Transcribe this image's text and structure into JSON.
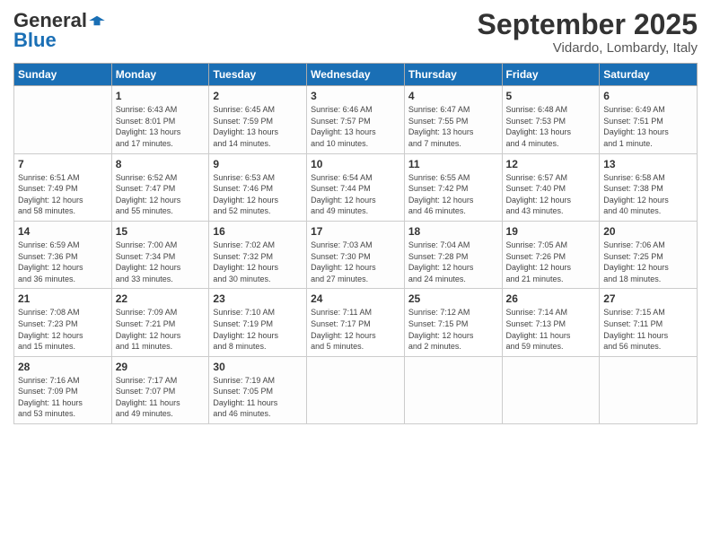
{
  "header": {
    "logo_general": "General",
    "logo_blue": "Blue",
    "month": "September 2025",
    "location": "Vidardo, Lombardy, Italy"
  },
  "days_of_week": [
    "Sunday",
    "Monday",
    "Tuesday",
    "Wednesday",
    "Thursday",
    "Friday",
    "Saturday"
  ],
  "weeks": [
    [
      {
        "day": "",
        "info": ""
      },
      {
        "day": "1",
        "info": "Sunrise: 6:43 AM\nSunset: 8:01 PM\nDaylight: 13 hours\nand 17 minutes."
      },
      {
        "day": "2",
        "info": "Sunrise: 6:45 AM\nSunset: 7:59 PM\nDaylight: 13 hours\nand 14 minutes."
      },
      {
        "day": "3",
        "info": "Sunrise: 6:46 AM\nSunset: 7:57 PM\nDaylight: 13 hours\nand 10 minutes."
      },
      {
        "day": "4",
        "info": "Sunrise: 6:47 AM\nSunset: 7:55 PM\nDaylight: 13 hours\nand 7 minutes."
      },
      {
        "day": "5",
        "info": "Sunrise: 6:48 AM\nSunset: 7:53 PM\nDaylight: 13 hours\nand 4 minutes."
      },
      {
        "day": "6",
        "info": "Sunrise: 6:49 AM\nSunset: 7:51 PM\nDaylight: 13 hours\nand 1 minute."
      }
    ],
    [
      {
        "day": "7",
        "info": "Sunrise: 6:51 AM\nSunset: 7:49 PM\nDaylight: 12 hours\nand 58 minutes."
      },
      {
        "day": "8",
        "info": "Sunrise: 6:52 AM\nSunset: 7:47 PM\nDaylight: 12 hours\nand 55 minutes."
      },
      {
        "day": "9",
        "info": "Sunrise: 6:53 AM\nSunset: 7:46 PM\nDaylight: 12 hours\nand 52 minutes."
      },
      {
        "day": "10",
        "info": "Sunrise: 6:54 AM\nSunset: 7:44 PM\nDaylight: 12 hours\nand 49 minutes."
      },
      {
        "day": "11",
        "info": "Sunrise: 6:55 AM\nSunset: 7:42 PM\nDaylight: 12 hours\nand 46 minutes."
      },
      {
        "day": "12",
        "info": "Sunrise: 6:57 AM\nSunset: 7:40 PM\nDaylight: 12 hours\nand 43 minutes."
      },
      {
        "day": "13",
        "info": "Sunrise: 6:58 AM\nSunset: 7:38 PM\nDaylight: 12 hours\nand 40 minutes."
      }
    ],
    [
      {
        "day": "14",
        "info": "Sunrise: 6:59 AM\nSunset: 7:36 PM\nDaylight: 12 hours\nand 36 minutes."
      },
      {
        "day": "15",
        "info": "Sunrise: 7:00 AM\nSunset: 7:34 PM\nDaylight: 12 hours\nand 33 minutes."
      },
      {
        "day": "16",
        "info": "Sunrise: 7:02 AM\nSunset: 7:32 PM\nDaylight: 12 hours\nand 30 minutes."
      },
      {
        "day": "17",
        "info": "Sunrise: 7:03 AM\nSunset: 7:30 PM\nDaylight: 12 hours\nand 27 minutes."
      },
      {
        "day": "18",
        "info": "Sunrise: 7:04 AM\nSunset: 7:28 PM\nDaylight: 12 hours\nand 24 minutes."
      },
      {
        "day": "19",
        "info": "Sunrise: 7:05 AM\nSunset: 7:26 PM\nDaylight: 12 hours\nand 21 minutes."
      },
      {
        "day": "20",
        "info": "Sunrise: 7:06 AM\nSunset: 7:25 PM\nDaylight: 12 hours\nand 18 minutes."
      }
    ],
    [
      {
        "day": "21",
        "info": "Sunrise: 7:08 AM\nSunset: 7:23 PM\nDaylight: 12 hours\nand 15 minutes."
      },
      {
        "day": "22",
        "info": "Sunrise: 7:09 AM\nSunset: 7:21 PM\nDaylight: 12 hours\nand 11 minutes."
      },
      {
        "day": "23",
        "info": "Sunrise: 7:10 AM\nSunset: 7:19 PM\nDaylight: 12 hours\nand 8 minutes."
      },
      {
        "day": "24",
        "info": "Sunrise: 7:11 AM\nSunset: 7:17 PM\nDaylight: 12 hours\nand 5 minutes."
      },
      {
        "day": "25",
        "info": "Sunrise: 7:12 AM\nSunset: 7:15 PM\nDaylight: 12 hours\nand 2 minutes."
      },
      {
        "day": "26",
        "info": "Sunrise: 7:14 AM\nSunset: 7:13 PM\nDaylight: 11 hours\nand 59 minutes."
      },
      {
        "day": "27",
        "info": "Sunrise: 7:15 AM\nSunset: 7:11 PM\nDaylight: 11 hours\nand 56 minutes."
      }
    ],
    [
      {
        "day": "28",
        "info": "Sunrise: 7:16 AM\nSunset: 7:09 PM\nDaylight: 11 hours\nand 53 minutes."
      },
      {
        "day": "29",
        "info": "Sunrise: 7:17 AM\nSunset: 7:07 PM\nDaylight: 11 hours\nand 49 minutes."
      },
      {
        "day": "30",
        "info": "Sunrise: 7:19 AM\nSunset: 7:05 PM\nDaylight: 11 hours\nand 46 minutes."
      },
      {
        "day": "",
        "info": ""
      },
      {
        "day": "",
        "info": ""
      },
      {
        "day": "",
        "info": ""
      },
      {
        "day": "",
        "info": ""
      }
    ]
  ]
}
